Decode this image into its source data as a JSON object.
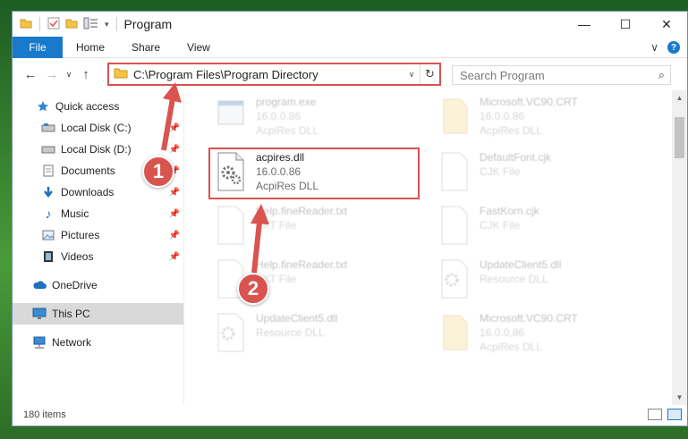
{
  "window": {
    "title": "Program",
    "minimize_glyph": "—",
    "maximize_glyph": "☐",
    "close_glyph": "✕"
  },
  "ribbon": {
    "tabs": [
      {
        "label": "File"
      },
      {
        "label": "Home"
      },
      {
        "label": "Share"
      },
      {
        "label": "View"
      }
    ],
    "expand_glyph": "∨",
    "help_glyph": "?"
  },
  "navigation": {
    "back_glyph": "←",
    "forward_glyph": "→",
    "recent_glyph": "∨",
    "up_glyph": "↑",
    "address_path": "C:\\Program Files\\Program Directory",
    "address_dropdown_glyph": "∨",
    "refresh_glyph": "↻",
    "search_placeholder": "Search Program",
    "search_glyph": "⌕"
  },
  "sidebar": {
    "items": [
      {
        "label": "Quick access",
        "icon": "star-icon",
        "pinned": false
      },
      {
        "label": "Local Disk (C:)",
        "icon": "drive-icon",
        "pinned": true
      },
      {
        "label": "Local Disk (D:)",
        "icon": "drive-icon",
        "pinned": true
      },
      {
        "label": "Documents",
        "icon": "documents-icon",
        "pinned": true
      },
      {
        "label": "Downloads",
        "icon": "download-icon",
        "pinned": true
      },
      {
        "label": "Music",
        "icon": "music-icon",
        "pinned": true
      },
      {
        "label": "Pictures",
        "icon": "pictures-icon",
        "pinned": true
      },
      {
        "label": "Videos",
        "icon": "videos-icon",
        "pinned": true
      },
      {
        "label": "OneDrive",
        "icon": "cloud-icon",
        "pinned": false
      },
      {
        "label": "This PC",
        "icon": "monitor-icon",
        "pinned": false,
        "selected": true
      },
      {
        "label": "Network",
        "icon": "network-icon",
        "pinned": false
      }
    ],
    "pin_glyph": "📌"
  },
  "files": [
    {
      "name": "program.exe",
      "line2": "16.0.0.86",
      "line3": "AcpiRes DLL",
      "icon": "exe-icon",
      "blurred": true
    },
    {
      "name": "Microsoft.VC90.CRT",
      "line2": "16.0.0.86",
      "line3": "AcpiRes DLL",
      "icon": "folder-icon",
      "blurred": true
    },
    {
      "name": "acpires.dll",
      "line2": "16.0.0.86",
      "line3": "AcpiRes DLL",
      "icon": "dll-gear-icon",
      "blurred": false
    },
    {
      "name": "DefaultFont.cjk",
      "line2": "CJK File",
      "line3": "",
      "icon": "blank-file-icon",
      "blurred": true
    },
    {
      "name": "Help.fineReader.txt",
      "line2": "TXT File",
      "line3": "",
      "icon": "blank-file-icon",
      "blurred": true
    },
    {
      "name": "FastKorn.cjk",
      "line2": "CJK File",
      "line3": "",
      "icon": "blank-file-icon",
      "blurred": true
    },
    {
      "name": "Help.fineReader.txt",
      "line2": "TXT File",
      "line3": "",
      "icon": "blank-file-icon",
      "blurred": true
    },
    {
      "name": "UpdateClient5.dll",
      "line2": "Resource DLL",
      "line3": "",
      "icon": "dll-gear-icon",
      "blurred": true
    },
    {
      "name": "UpdateClient5.dll",
      "line2": "Resource DLL",
      "line3": "",
      "icon": "dll-gear-icon",
      "blurred": true
    },
    {
      "name": "Microsoft.VC90.CRT",
      "line2": "16.0.0.86",
      "line3": "AcpiRes DLL",
      "icon": "folder-icon",
      "blurred": true
    }
  ],
  "scrollbar": {
    "up_glyph": "▲",
    "down_glyph": "▼"
  },
  "status": {
    "item_count": "180 items"
  },
  "annotations": {
    "step1": "1",
    "step2": "2"
  },
  "colors": {
    "accent": "#1979ca",
    "highlight": "#d9534f"
  }
}
